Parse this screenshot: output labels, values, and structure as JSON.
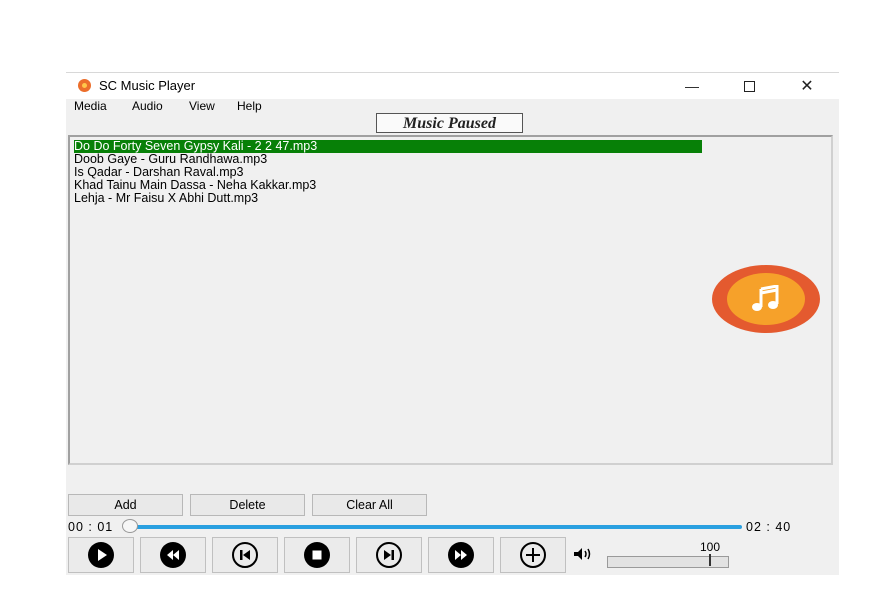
{
  "window": {
    "title": "SC Music Player",
    "min_glyph": "—",
    "close_glyph": "✕"
  },
  "menu": [
    "Media",
    "Audio",
    "View",
    "Help"
  ],
  "status": "Music Paused",
  "playlist": [
    "Do Do Forty Seven Gypsy Kali - 2 2 47.mp3",
    "Doob Gaye - Guru Randhawa.mp3",
    "Is Qadar - Darshan Raval.mp3",
    "Khad Tainu Main Dassa - Neha Kakkar.mp3",
    "Lehja - Mr Faisu X Abhi Dutt.mp3"
  ],
  "selected_index": 0,
  "buttons": {
    "add": "Add",
    "delete": "Delete",
    "clear_all": "Clear All"
  },
  "time": {
    "elapsed": "00 : 01",
    "total": "02 : 40"
  },
  "volume": "100",
  "colors": {
    "selection": "#078007",
    "progress": "#2aa0e0",
    "fab_outer": "#e45a2f",
    "fab_inner": "#f6a12a"
  }
}
